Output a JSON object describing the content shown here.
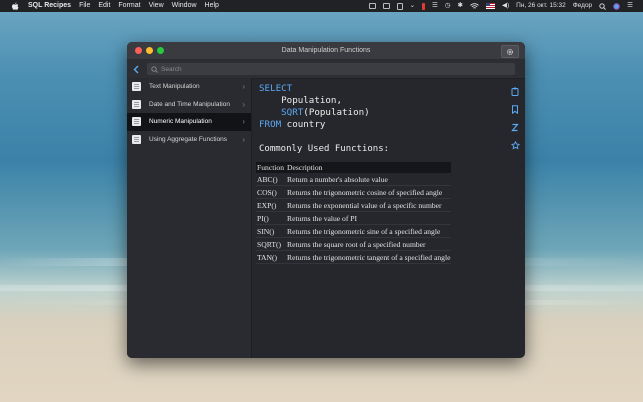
{
  "menubar": {
    "app_name": "SQL Recipes",
    "items": [
      "File",
      "Edit",
      "Format",
      "View",
      "Window",
      "Help"
    ],
    "date_time": "Пн, 26 окт.  15:32",
    "user": "Федор"
  },
  "window": {
    "title": "Data Manipulation Functions"
  },
  "search": {
    "placeholder": "Search"
  },
  "sidebar": {
    "items": [
      {
        "label": "Text Manipulation"
      },
      {
        "label": "Date and Time Manipulation"
      },
      {
        "label": "Numeric Manipulation"
      },
      {
        "label": "Using Aggregate Functions"
      }
    ],
    "selected_index": 2
  },
  "code": {
    "line1_kw": "SELECT",
    "line2": "    Population,",
    "line3_fn": "SQRT",
    "line3_rest": "(Population)",
    "line4_kw": "FROM",
    "line4_rest": " country"
  },
  "functions": {
    "heading": "Commonly Used Functions:",
    "columns": [
      "Function",
      "Description"
    ],
    "rows": [
      [
        "ABC()",
        "Return a number's absolute value"
      ],
      [
        "COS()",
        "Returns the trigonometric cosine of specified angle"
      ],
      [
        "EXP()",
        "Returns the exponential value of a specific number"
      ],
      [
        "PI()",
        "Returns the value of PI"
      ],
      [
        "SIN()",
        "Returns the trigonometric sine of a specified angle"
      ],
      [
        "SQRT()",
        "Returns the square root of a specified number"
      ],
      [
        "TAN()",
        "Returns the trigonometric tangent of a specified angle"
      ]
    ]
  },
  "colors": {
    "accent": "#5aa9f3",
    "close": "#fe5f57",
    "minimize": "#febc2e",
    "zoom": "#28c840"
  }
}
